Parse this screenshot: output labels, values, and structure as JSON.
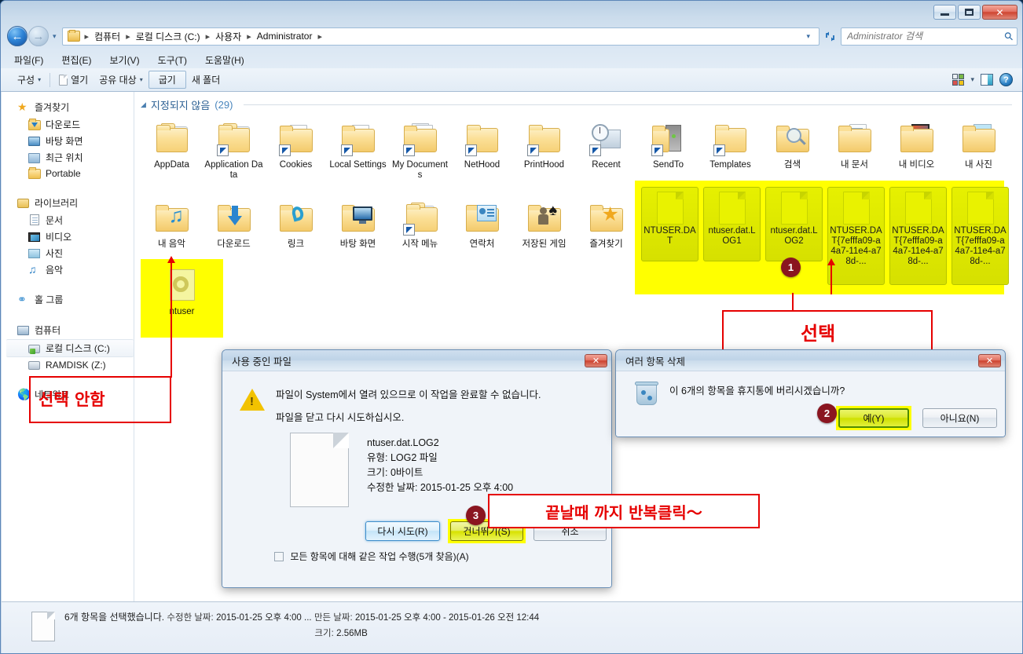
{
  "window": {
    "title_buttons": {
      "minimize": "–",
      "maximize": "□",
      "close": "✕"
    }
  },
  "address_bar": {
    "back_glyph": "←",
    "forward_glyph": "→",
    "dropdown_glyph": "▾",
    "crumbs": [
      "컴퓨터",
      "로컬 디스크 (C:)",
      "사용자",
      "Administrator"
    ],
    "separator": "▸",
    "refresh_glyph": "↻",
    "search_placeholder": "Administrator 검색",
    "search_value": "",
    "search_icon": "⚲"
  },
  "menubar": {
    "items": [
      {
        "label": "파일(F)"
      },
      {
        "label": "편집(E)"
      },
      {
        "label": "보기(V)"
      },
      {
        "label": "도구(T)"
      },
      {
        "label": "도움말(H)"
      }
    ]
  },
  "toolbar": {
    "organize": "구성",
    "open": "열기",
    "share": "공유 대상",
    "burn": "굽기",
    "new_folder": "새 폴더",
    "caret": "▾",
    "help": "?"
  },
  "sidebar": {
    "groups": [
      {
        "head": {
          "label": "즐겨찾기",
          "icon": "star-icon"
        },
        "children": [
          {
            "label": "다운로드",
            "icon": "download-folder-icon"
          },
          {
            "label": "바탕 화면",
            "icon": "desktop-icon"
          },
          {
            "label": "최근 위치",
            "icon": "recent-places-icon"
          },
          {
            "label": "Portable",
            "icon": "folder-icon"
          }
        ]
      },
      {
        "head": {
          "label": "라이브러리",
          "icon": "libraries-icon"
        },
        "children": [
          {
            "label": "문서",
            "icon": "documents-icon"
          },
          {
            "label": "비디오",
            "icon": "videos-icon"
          },
          {
            "label": "사진",
            "icon": "pictures-icon"
          },
          {
            "label": "음악",
            "icon": "music-icon"
          }
        ]
      },
      {
        "head": {
          "label": "홀 그룹",
          "icon": "homegroup-icon"
        },
        "children": []
      },
      {
        "head": {
          "label": "컴퓨터",
          "icon": "computer-icon"
        },
        "children": [
          {
            "label": "로컬 디스크 (C:)",
            "icon": "system-drive-icon",
            "selected": true
          },
          {
            "label": "RAMDISK (Z:)",
            "icon": "drive-icon"
          }
        ]
      },
      {
        "head": {
          "label": "네트워크",
          "icon": "network-icon"
        },
        "children": []
      }
    ]
  },
  "filepane": {
    "group_header": {
      "triangle": "◢",
      "label": "지정되지 않음",
      "count": "(29)"
    },
    "row1": [
      {
        "name": "AppData",
        "icon": "folder-stack-icon",
        "shortcut": false
      },
      {
        "name": "Application Data",
        "icon": "folder-stack-icon",
        "shortcut": true
      },
      {
        "name": "Cookies",
        "icon": "folder-page-icon",
        "shortcut": true
      },
      {
        "name": "Local Settings",
        "icon": "folder-page-icon",
        "shortcut": true
      },
      {
        "name": "My Documents",
        "icon": "folder-docs-icon",
        "shortcut": true
      },
      {
        "name": "NetHood",
        "icon": "folder-icon",
        "shortcut": true
      },
      {
        "name": "PrintHood",
        "icon": "folder-icon",
        "shortcut": true
      },
      {
        "name": "Recent",
        "icon": "recent-clock-icon",
        "shortcut": true
      },
      {
        "name": "SendTo",
        "icon": "sendto-icon",
        "shortcut": true
      },
      {
        "name": "Templates",
        "icon": "folder-icon",
        "shortcut": true
      },
      {
        "name": "검색",
        "icon": "search-folder-icon",
        "shortcut": false
      },
      {
        "name": "내 문서",
        "icon": "my-documents-icon",
        "shortcut": false
      },
      {
        "name": "내 비디오",
        "icon": "my-videos-icon",
        "shortcut": false
      },
      {
        "name": "내 사진",
        "icon": "my-pictures-icon",
        "shortcut": false
      }
    ],
    "row2": [
      {
        "name": "내 음악",
        "icon": "my-music-icon",
        "shortcut": false
      },
      {
        "name": "다운로드",
        "icon": "downloads-folder-icon",
        "shortcut": false
      },
      {
        "name": "링크",
        "icon": "links-folder-icon",
        "shortcut": false
      },
      {
        "name": "바탕 화면",
        "icon": "desktop-folder-icon",
        "shortcut": false
      },
      {
        "name": "시작 메뉴",
        "icon": "start-menu-folder-icon",
        "shortcut": true
      },
      {
        "name": "연락처",
        "icon": "contacts-folder-icon",
        "shortcut": false
      },
      {
        "name": "저장된 게임",
        "icon": "saved-games-folder-icon",
        "shortcut": false
      },
      {
        "name": "즐겨찾기",
        "icon": "favorites-folder-icon",
        "shortcut": false
      }
    ],
    "selected_files": [
      {
        "name": "NTUSER.DAT"
      },
      {
        "name": "ntuser.dat.LOG1"
      },
      {
        "name": "ntuser.dat.LOG2"
      },
      {
        "name": "NTUSER.DAT{7efffa09-a4a7-11e4-a78d-..."
      },
      {
        "name": "NTUSER.DAT{7efffa09-a4a7-11e4-a78d-..."
      },
      {
        "name": "NTUSER.DAT{7efffa09-a4a7-11e4-a78d-..."
      }
    ],
    "unselected_file": {
      "name": "ntuser",
      "icon": "ini-config-file-icon"
    }
  },
  "statusbar": {
    "line1_main": "6개 항목을 선택했습니다.",
    "line1_modified_label": "수정한 날짜:",
    "line1_modified_value": "2015-01-25 오후 4:00 ...",
    "line1_created_label": "만든 날짜:",
    "line1_created_value": "2015-01-25 오후 4:00 - 2015-01-26 오전 12:44",
    "line2_label": "크기:",
    "line2_value": "2.56MB"
  },
  "dialog_file_in_use": {
    "title": "사용 중인 파일",
    "close_glyph": "✕",
    "message_line1": "파일이 System에서 열려 있으므로 이 작업을 완료할 수 없습니다.",
    "message_line2": "파일을 닫고 다시 시도하십시오.",
    "file_name": "ntuser.dat.LOG2",
    "file_type": "유형: LOG2 파일",
    "file_size": "크기: 0바이트",
    "file_modified": "수정한 날짜: 2015-01-25 오후 4:00",
    "btn_retry": "다시 시도(R)",
    "btn_skip": "건너뛰기(S)",
    "btn_cancel": "취소",
    "checkbox_label": "모든 항목에 대해 같은 작업 수행(5개 찾음)(A)",
    "checkbox_checked": false
  },
  "dialog_delete_items": {
    "title": "여러 항목 삭제",
    "close_glyph": "✕",
    "message": "이 6개의 항목을 휴지통에 버리시겠습니까?",
    "btn_yes": "예(Y)",
    "btn_no": "아니요(N)",
    "icon": "recycle-bin-icon"
  },
  "annotations": {
    "badge1": "1",
    "badge2": "2",
    "badge3": "3",
    "label_select": "선택",
    "label_not_select": "선택  안함",
    "label_repeat_click": "끝날때  까지  반복클릭～",
    "accent_color": "#e60000",
    "badge_color": "#8a1520",
    "highlight_color": "#ffff00"
  }
}
